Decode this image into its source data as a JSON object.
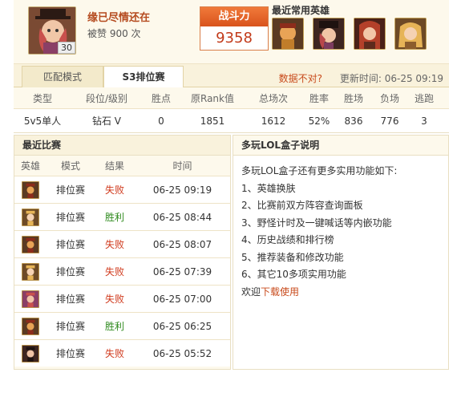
{
  "summoner": {
    "name": "缘已尽情还在",
    "likes": "被赞 900 次",
    "level": "30"
  },
  "power": {
    "label": "战斗力",
    "value": "9358"
  },
  "favorite_heroes": {
    "title": "最近常用英雄",
    "heroes": [
      "hero-avatar-1",
      "hero-avatar-2",
      "hero-avatar-3",
      "hero-avatar-4"
    ]
  },
  "tabs": [
    {
      "label": "匹配模式",
      "active": false
    },
    {
      "label": "S3排位赛",
      "active": true
    }
  ],
  "data_wrong_link": "数据不对?",
  "update_time": "更新时间: 06-25 09:19",
  "rank_table": {
    "headers": [
      "类型",
      "段位/级别",
      "胜点",
      "原Rank值",
      "总场次",
      "胜率",
      "胜场",
      "负场",
      "逃跑"
    ],
    "row": [
      "5v5单人",
      "钻石 V",
      "0",
      "1851",
      "1612",
      "52%",
      "836",
      "776",
      "3"
    ]
  },
  "recent_matches": {
    "title": "最近比赛",
    "headers": [
      "英雄",
      "模式",
      "结果",
      "时间"
    ],
    "rows": [
      {
        "mode": "排位赛",
        "result": "失败",
        "time": "06-25 09:19",
        "win": false
      },
      {
        "mode": "排位赛",
        "result": "胜利",
        "time": "06-25 08:44",
        "win": true
      },
      {
        "mode": "排位赛",
        "result": "失败",
        "time": "06-25 08:07",
        "win": false
      },
      {
        "mode": "排位赛",
        "result": "失败",
        "time": "06-25 07:39",
        "win": false
      },
      {
        "mode": "排位赛",
        "result": "失败",
        "time": "06-25 07:00",
        "win": false
      },
      {
        "mode": "排位赛",
        "result": "胜利",
        "time": "06-25 06:25",
        "win": true
      },
      {
        "mode": "排位赛",
        "result": "失败",
        "time": "06-25 05:52",
        "win": false
      }
    ]
  },
  "tips": {
    "title": "多玩LOL盒子说明",
    "intro": "多玩LOL盒子还有更多实用功能如下:",
    "items": [
      "1、英雄换肤",
      "2、比赛前双方阵容查询面板",
      "3、野怪计时及一键喊话等内嵌功能",
      "4、历史战绩和排行榜",
      "5、推荐装备和修改功能",
      "6、其它10多项实用功能"
    ],
    "footer_prefix": "欢迎",
    "footer_link": "下载使用"
  },
  "colors": {
    "accent_orange": "#d9531c",
    "lose_red": "#d03a1d",
    "win_green": "#2f8a1e",
    "header_bg": "#fdf9ec"
  }
}
